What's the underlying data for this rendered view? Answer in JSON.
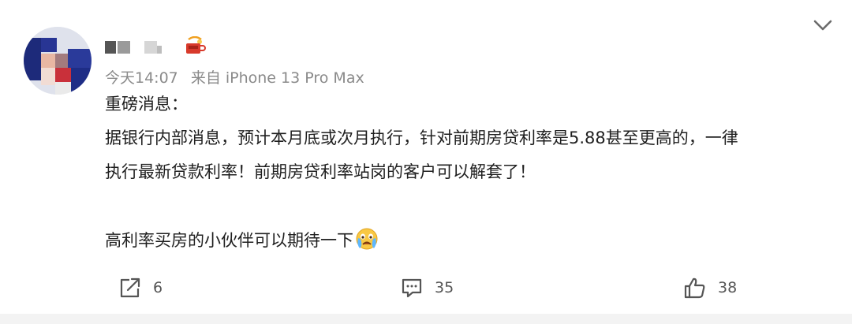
{
  "post": {
    "time": "今天14:07",
    "source": "来自 iPhone 13 Pro Max",
    "title_line": "重磅消息：",
    "line1": "据银行内部消息，预计本月底或次月执行，针对前期房贷利率是5.88甚至更高的，一律",
    "line2": "执行最新贷款利率！前期房贷利率站岗的客户可以解套了！",
    "line3": "高利率买房的小伙伴可以期待一下"
  },
  "actions": {
    "share_count": "6",
    "comment_count": "35",
    "like_count": "38"
  },
  "icons": {
    "vip": "vip-badge-icon",
    "menu": "chevron-down-icon",
    "share": "share-icon",
    "comment": "comment-icon",
    "like": "thumbs-up-icon",
    "emoji": "tearful-face-icon"
  },
  "colors": {
    "meta_text": "#8a8a8a",
    "body_text": "#1f1f1f",
    "action_text": "#555555"
  }
}
